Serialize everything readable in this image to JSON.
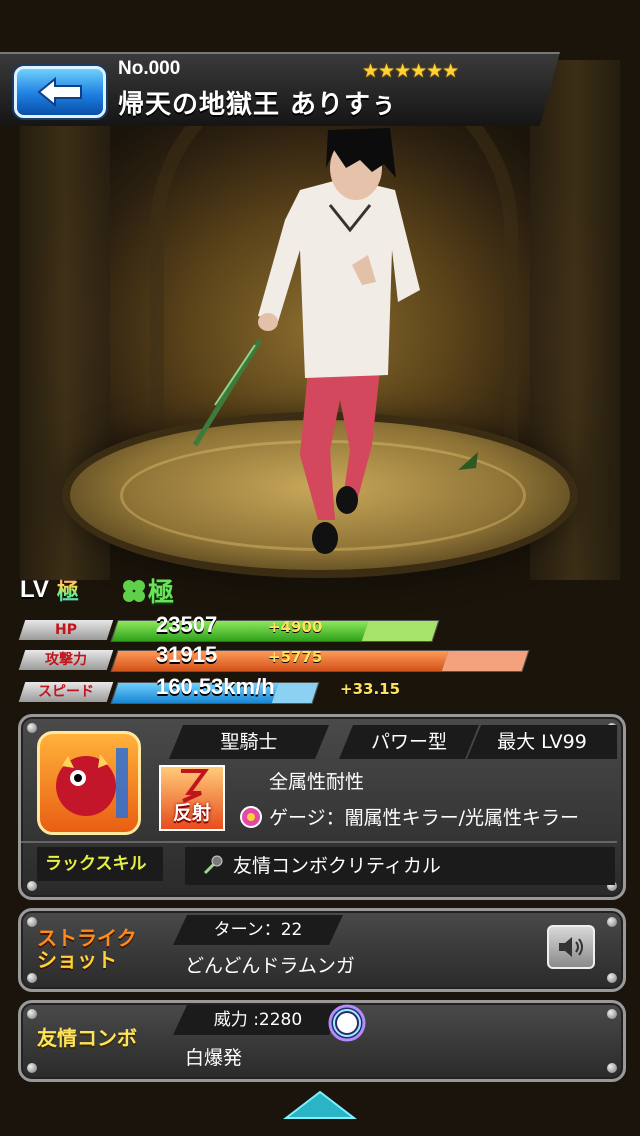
{
  "header": {
    "number": "No.000",
    "name": "帰天の地獄王 ありすぅ",
    "rarity_stars": "★★★★★★"
  },
  "level": {
    "label": "LV",
    "level_value": "極",
    "luck_value": "極"
  },
  "stats": [
    {
      "label": "HP",
      "value": "23507",
      "bonus": "+4900",
      "color": "#5fcf3a",
      "bonus_color": "#a6e36a"
    },
    {
      "label": "攻撃力",
      "value": "31915",
      "bonus": "+5775",
      "color": "#ee6a24",
      "bonus_color": "#f3a27d"
    },
    {
      "label": "スピード",
      "value": "160.53km/h",
      "bonus": "+33.15",
      "color": "#2aa6e8",
      "bonus_color": "#8ad1f2"
    }
  ],
  "info": {
    "tribe": "聖騎士",
    "type": "パワー型",
    "max_level": "最大 LV99",
    "ability_icon_text": "反射",
    "ability": "全属性耐性",
    "gauge": "ゲージ：闇属性キラー/光属性キラー",
    "luck_skill_label": "ラックスキル",
    "luck_skill": "友情コンボクリティカル"
  },
  "strike_shot": {
    "title_line1": "ストライク",
    "title_line2": "ショット",
    "turns": "ターン：22",
    "name": "どんどんドラムンガ"
  },
  "friendship": {
    "title": "友情コンボ",
    "power": "威力 :2280",
    "name": "白爆発"
  },
  "colors": {
    "accent_blue": "#1d7fe0",
    "star_gold": "#ffd23a",
    "strike_orange": "#ff8a1e",
    "luck_yellow": "#e9f044"
  },
  "icons": [
    "back-arrow-icon",
    "rainbow-kyoku-icon",
    "clover-icon",
    "reflect-icon",
    "gauge-icon",
    "luck-skill-icon",
    "speaker-icon",
    "white-burst-icon",
    "scroll-up-icon"
  ]
}
